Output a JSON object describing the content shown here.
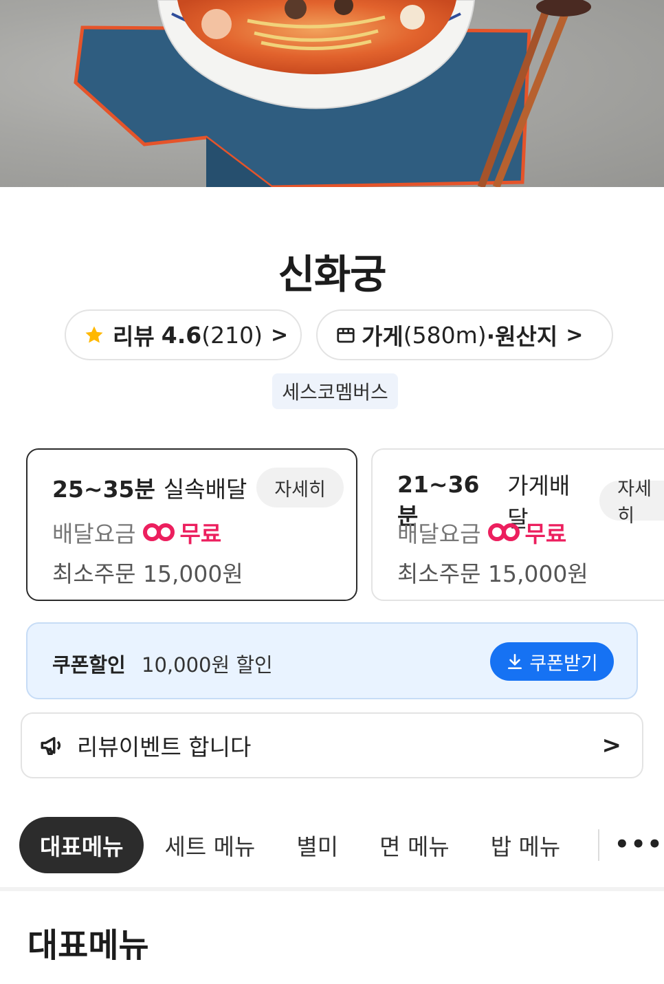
{
  "store": {
    "name": "신화궁"
  },
  "review_pill": {
    "label": "리뷰",
    "rating": "4.6",
    "count": "(210)"
  },
  "store_pill": {
    "label": "가게",
    "distance": "(580m)",
    "origin": "·원산지"
  },
  "tag": "세스코멤버스",
  "delivery_options": [
    {
      "time": "25~35분",
      "type": "실속배달",
      "detail": "자세히",
      "fee_label": "배달요금",
      "fee": "무료",
      "min_label": "최소주문",
      "min_value": "15,000원"
    },
    {
      "time": "21~36분",
      "type": "가게배달",
      "detail": "자세히",
      "fee_label": "배달요금",
      "fee": "무료",
      "min_label": "최소주문",
      "min_value": "15,000원"
    }
  ],
  "coupon": {
    "label": "쿠폰할인",
    "amount": "10,000원 할인",
    "button": "쿠폰받기"
  },
  "event": {
    "text": "리뷰이벤트 합니다"
  },
  "tabs": [
    "대표메뉴",
    "세트 메뉴",
    "별미",
    "면 메뉴",
    "밥 메뉴"
  ],
  "section_title": "대표메뉴",
  "colors": {
    "accent_blue": "#1672f3",
    "free_red": "#ec1f5e",
    "coupon_bg": "#e9f3ff"
  },
  "icons": [
    "star-icon",
    "store-icon",
    "chevron-right-icon",
    "free-delivery-badge-icon",
    "download-icon",
    "megaphone-icon",
    "more-icon"
  ]
}
